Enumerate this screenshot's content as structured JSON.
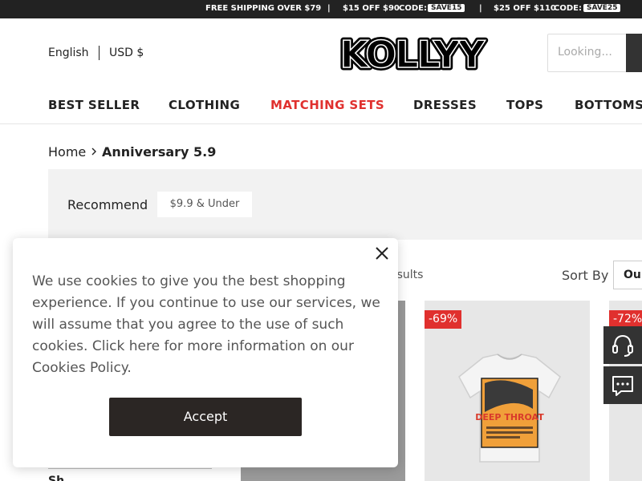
{
  "promo": {
    "shipping": "FREE SHIPPING OVER $79",
    "sep": "|",
    "offer1": "$15 OFF $90",
    "offer1_code_label": "CODE:",
    "offer1_code": "SAVE15",
    "offer2": "$25 OFF $110",
    "offer2_code_label": "CODE:",
    "offer2_code": "SAVE25"
  },
  "header": {
    "language": "English",
    "currency": "USD $",
    "logo_text": "KOLLYY",
    "search_placeholder": "Looking..."
  },
  "nav": [
    "BEST SELLER",
    "CLOTHING",
    "MATCHING SETS",
    "DRESSES",
    "TOPS",
    "BOTTOMS"
  ],
  "breadcrumb": {
    "home": "Home",
    "current": "Anniversary 5.9"
  },
  "filters": {
    "recommend": "Recommend",
    "chip": "$9.9 & Under"
  },
  "listing": {
    "results": "esults",
    "sort_label": "Sort By",
    "sort_value": "Our"
  },
  "products": [
    {
      "discount": ""
    },
    {
      "discount": "-69%",
      "print_text": "DEEP THROAT"
    },
    {
      "discount": "-72%"
    }
  ],
  "cookie": {
    "text": "We use cookies to give you the best shopping experience. If you continue to use our services, we will assume that you agree to the use of such cookies. Click here for more information on our Cookies Policy.",
    "accept": "Accept"
  },
  "sidebar_partial": "Sh",
  "colors": {
    "accent_red": "#e0302e",
    "dark": "#222222",
    "button": "#2b2624"
  }
}
